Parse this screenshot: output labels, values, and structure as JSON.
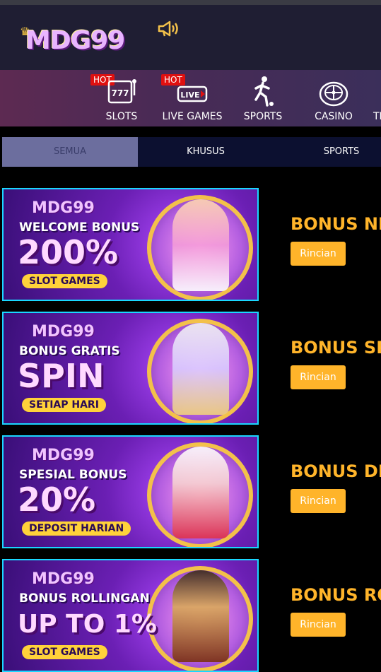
{
  "header": {
    "logo_text": "MDG99"
  },
  "nav": {
    "items": [
      {
        "label": "SLOTS",
        "badge": "HOT",
        "icon": "slot-machine-icon"
      },
      {
        "label": "LIVE GAMES",
        "badge": "HOT",
        "icon": "live-icon"
      },
      {
        "label": "SPORTS",
        "icon": "soccer-player-icon"
      },
      {
        "label": "CASINO",
        "icon": "roulette-icon"
      },
      {
        "label": "TI",
        "icon": "ticket-icon"
      }
    ]
  },
  "tabs": [
    {
      "label": "SEMUA",
      "active": true
    },
    {
      "label": "KHUSUS"
    },
    {
      "label": "SPORTS"
    }
  ],
  "promos": [
    {
      "title": "BONUS NE",
      "button": "Rincian",
      "banner": {
        "brand": "MDG99",
        "line1": "WELCOME BONUS",
        "big": "200%",
        "pill": "SLOT GAMES"
      }
    },
    {
      "title": "BONUS SP",
      "button": "Rincian",
      "banner": {
        "brand": "MDG99",
        "line1": "BONUS GRATIS",
        "big": "SPIN",
        "pill": "SETIAP HARI"
      }
    },
    {
      "title": "BONUS DE",
      "button": "Rincian",
      "banner": {
        "brand": "MDG99",
        "line1": "SPESIAL BONUS",
        "big": "20%",
        "pill": "DEPOSIT HARIAN"
      }
    },
    {
      "title": "BONUS RO",
      "button": "Rincian",
      "banner": {
        "brand": "MDG99",
        "line1": "BONUS ROLLINGAN",
        "big": "UP TO 1%",
        "pill": "SLOT GAMES"
      }
    }
  ],
  "colors": {
    "accent": "#ffb42a",
    "header_bg": "#1f1e33",
    "tabs_bg": "#0c1030",
    "active_tab": "#6c6e9e",
    "banner_border": "#1ad7ff"
  }
}
